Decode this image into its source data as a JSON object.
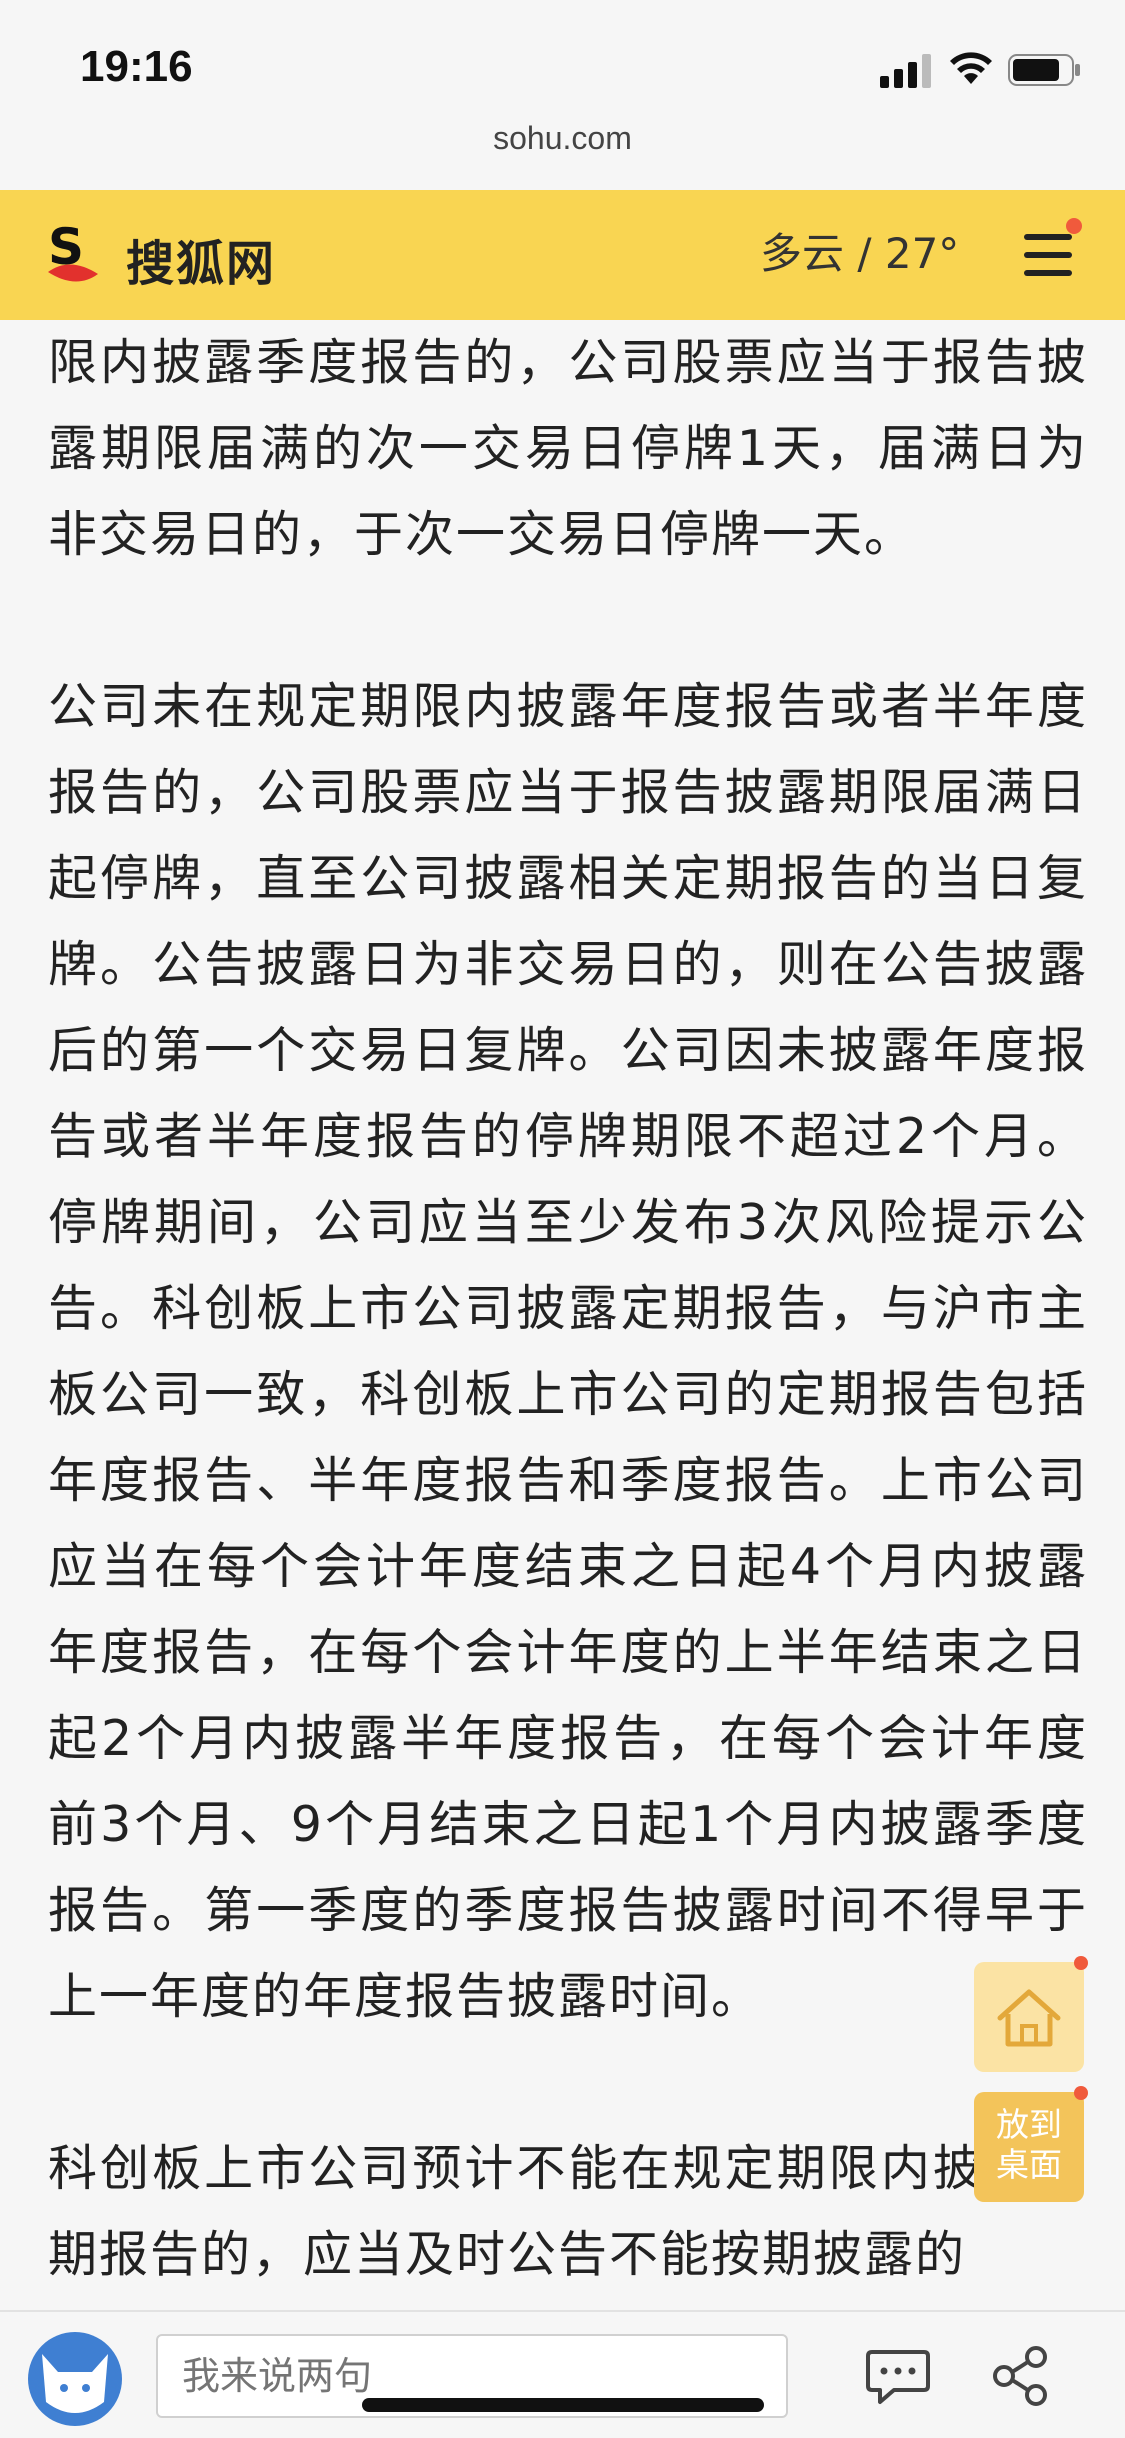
{
  "status_bar": {
    "time": "19:16",
    "url": "sohu.com"
  },
  "header": {
    "logo_text": "搜狐网",
    "weather": "多云 / 27°",
    "colors": {
      "background": "#f9d552",
      "notification_dot": "#f05a3c"
    }
  },
  "article": {
    "paragraphs": [
      "限内披露季度报告的，公司股票应当于报告披露期限届满的次一交易日停牌1天，届满日为非交易日的，于次一交易日停牌一天。",
      "公司未在规定期限内披露年度报告或者半年度报告的，公司股票应当于报告披露期限届满日起停牌，直至公司披露相关定期报告的当日复牌。公告披露日为非交易日的，则在公告披露后的第一个交易日复牌。公司因未披露年度报告或者半年度报告的停牌期限不超过2个月。停牌期间，公司应当至少发布3次风险提示公告。科创板上市公司披露定期报告，与沪市主板公司一致，科创板上市公司的定期报告包括年度报告、半年度报告和季度报告。上市公司应当在每个会计年度结束之日起4个月内披露年度报告，在每个会计年度的上半年结束之日起2个月内披露半年度报告，在每个会计年度前3个月、9个月结束之日起1个月内披露季度报告。第一季度的季度报告披露时间不得早于上一年度的年度报告披露时间。",
      "科创板上市公司预计不能在规定期限内披露定期报告的，应当及时公告不能按期披露的"
    ]
  },
  "floating": {
    "home_icon": "home-icon",
    "desktop_line1": "放到",
    "desktop_line2": "桌面"
  },
  "bottom_bar": {
    "comment_placeholder": "我来说两句",
    "icons": [
      "avatar",
      "comment-icon",
      "share-icon"
    ]
  }
}
